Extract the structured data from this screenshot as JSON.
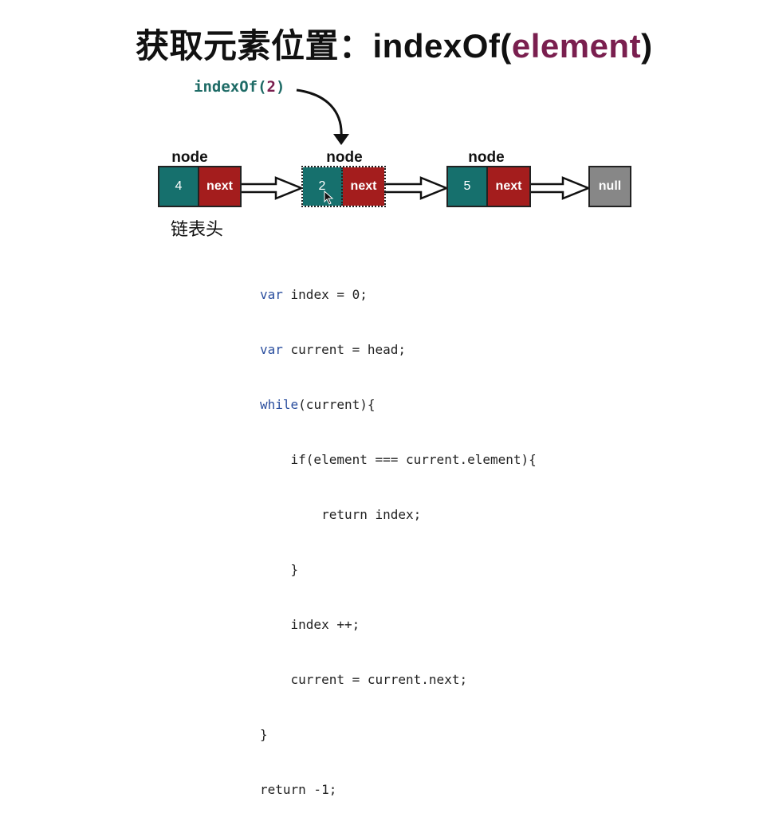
{
  "title": {
    "prefix": "获取元素位置：indexOf(",
    "arg": "element",
    "suffix": ")"
  },
  "call": {
    "prefix": "indexOf(",
    "arg": "2",
    "suffix": ")"
  },
  "nodes": [
    {
      "label": "node",
      "value": "4",
      "next": "next"
    },
    {
      "label": "node",
      "value": "2",
      "next": "next"
    },
    {
      "label": "node",
      "value": "5",
      "next": "next"
    }
  ],
  "null_label": "null",
  "head_label": "链表头",
  "colors": {
    "value_cell": "#16706d",
    "next_cell": "#a41d1d",
    "null_cell": "#878787",
    "title_arg": "#7a1f4f",
    "call_text": "#1e6b66"
  },
  "code": {
    "l1_kw": "var",
    "l1_rest": " index = 0;",
    "l2_kw": "var",
    "l2_rest": " current = head;",
    "l3_kw": "while",
    "l3_rest": "(current){",
    "l4": "    if(element === current.element){",
    "l5": "        return index;",
    "l6": "    }",
    "l7": "    index ++;",
    "l8": "    current = current.next;",
    "l9": "}",
    "l10": "return -1;"
  }
}
